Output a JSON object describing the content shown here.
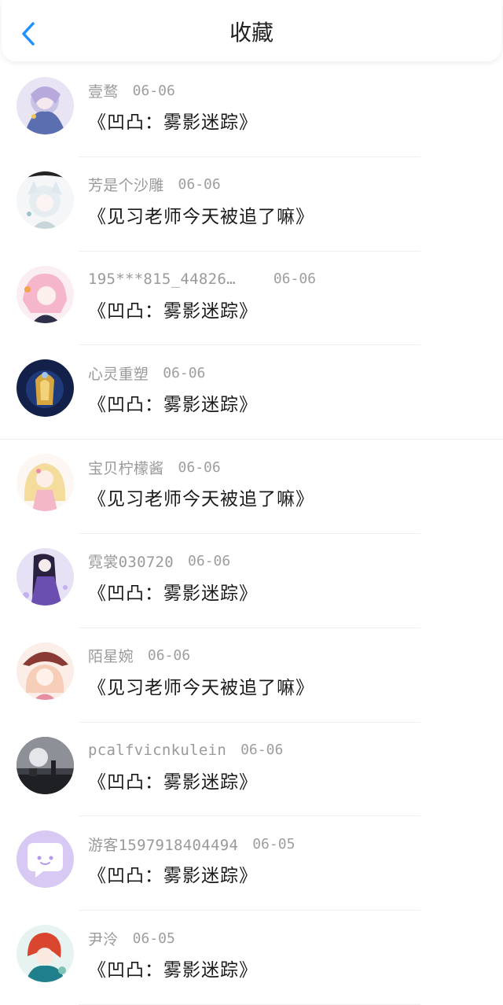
{
  "header": {
    "title": "收藏"
  },
  "colors": {
    "accent": "#1e90ff",
    "text_primary": "#1a1a1a",
    "text_secondary": "#9a9a9a",
    "divider": "#efefef"
  },
  "items": [
    {
      "username": "壹鹜",
      "date": "06-06",
      "book": "《凹凸：雾影迷踪》",
      "avatar": "anime-girl-lavender"
    },
    {
      "username": "芳是个沙雕",
      "date": "06-06",
      "book": "《见习老师今天被追了嘛》",
      "avatar": "anime-white-cat-ear"
    },
    {
      "username": "195***815_44826…",
      "date": "06-06",
      "book": "《凹凸：雾影迷踪》",
      "avatar": "anime-pink-hair"
    },
    {
      "username": "心灵重塑",
      "date": "06-06",
      "book": "《凹凸：雾影迷踪》",
      "avatar": "golden-emblem-dark-blue"
    },
    {
      "username": "宝贝柠檬酱",
      "date": "06-06",
      "book": "《见习老师今天被追了嘛》",
      "avatar": "anime-blonde-pink-dress"
    },
    {
      "username": "霓裳030720",
      "date": "06-06",
      "book": "《凹凸：雾影迷踪》",
      "avatar": "anime-purple-kimono"
    },
    {
      "username": "陌星婉",
      "date": "06-06",
      "book": "《见习老师今天被追了嘛》",
      "avatar": "anime-girl-hat"
    },
    {
      "username": "pcalfvicnkulein",
      "date": "06-06",
      "book": "《凹凸：雾影迷踪》",
      "avatar": "night-moon-silhouette"
    },
    {
      "username": "游客1597918404494",
      "date": "06-05",
      "book": "《凹凸：雾影迷踪》",
      "avatar": "default-chat-icon"
    },
    {
      "username": "尹泠",
      "date": "06-05",
      "book": "《凹凸：雾影迷踪》",
      "avatar": "anime-red-hair-teal"
    }
  ]
}
